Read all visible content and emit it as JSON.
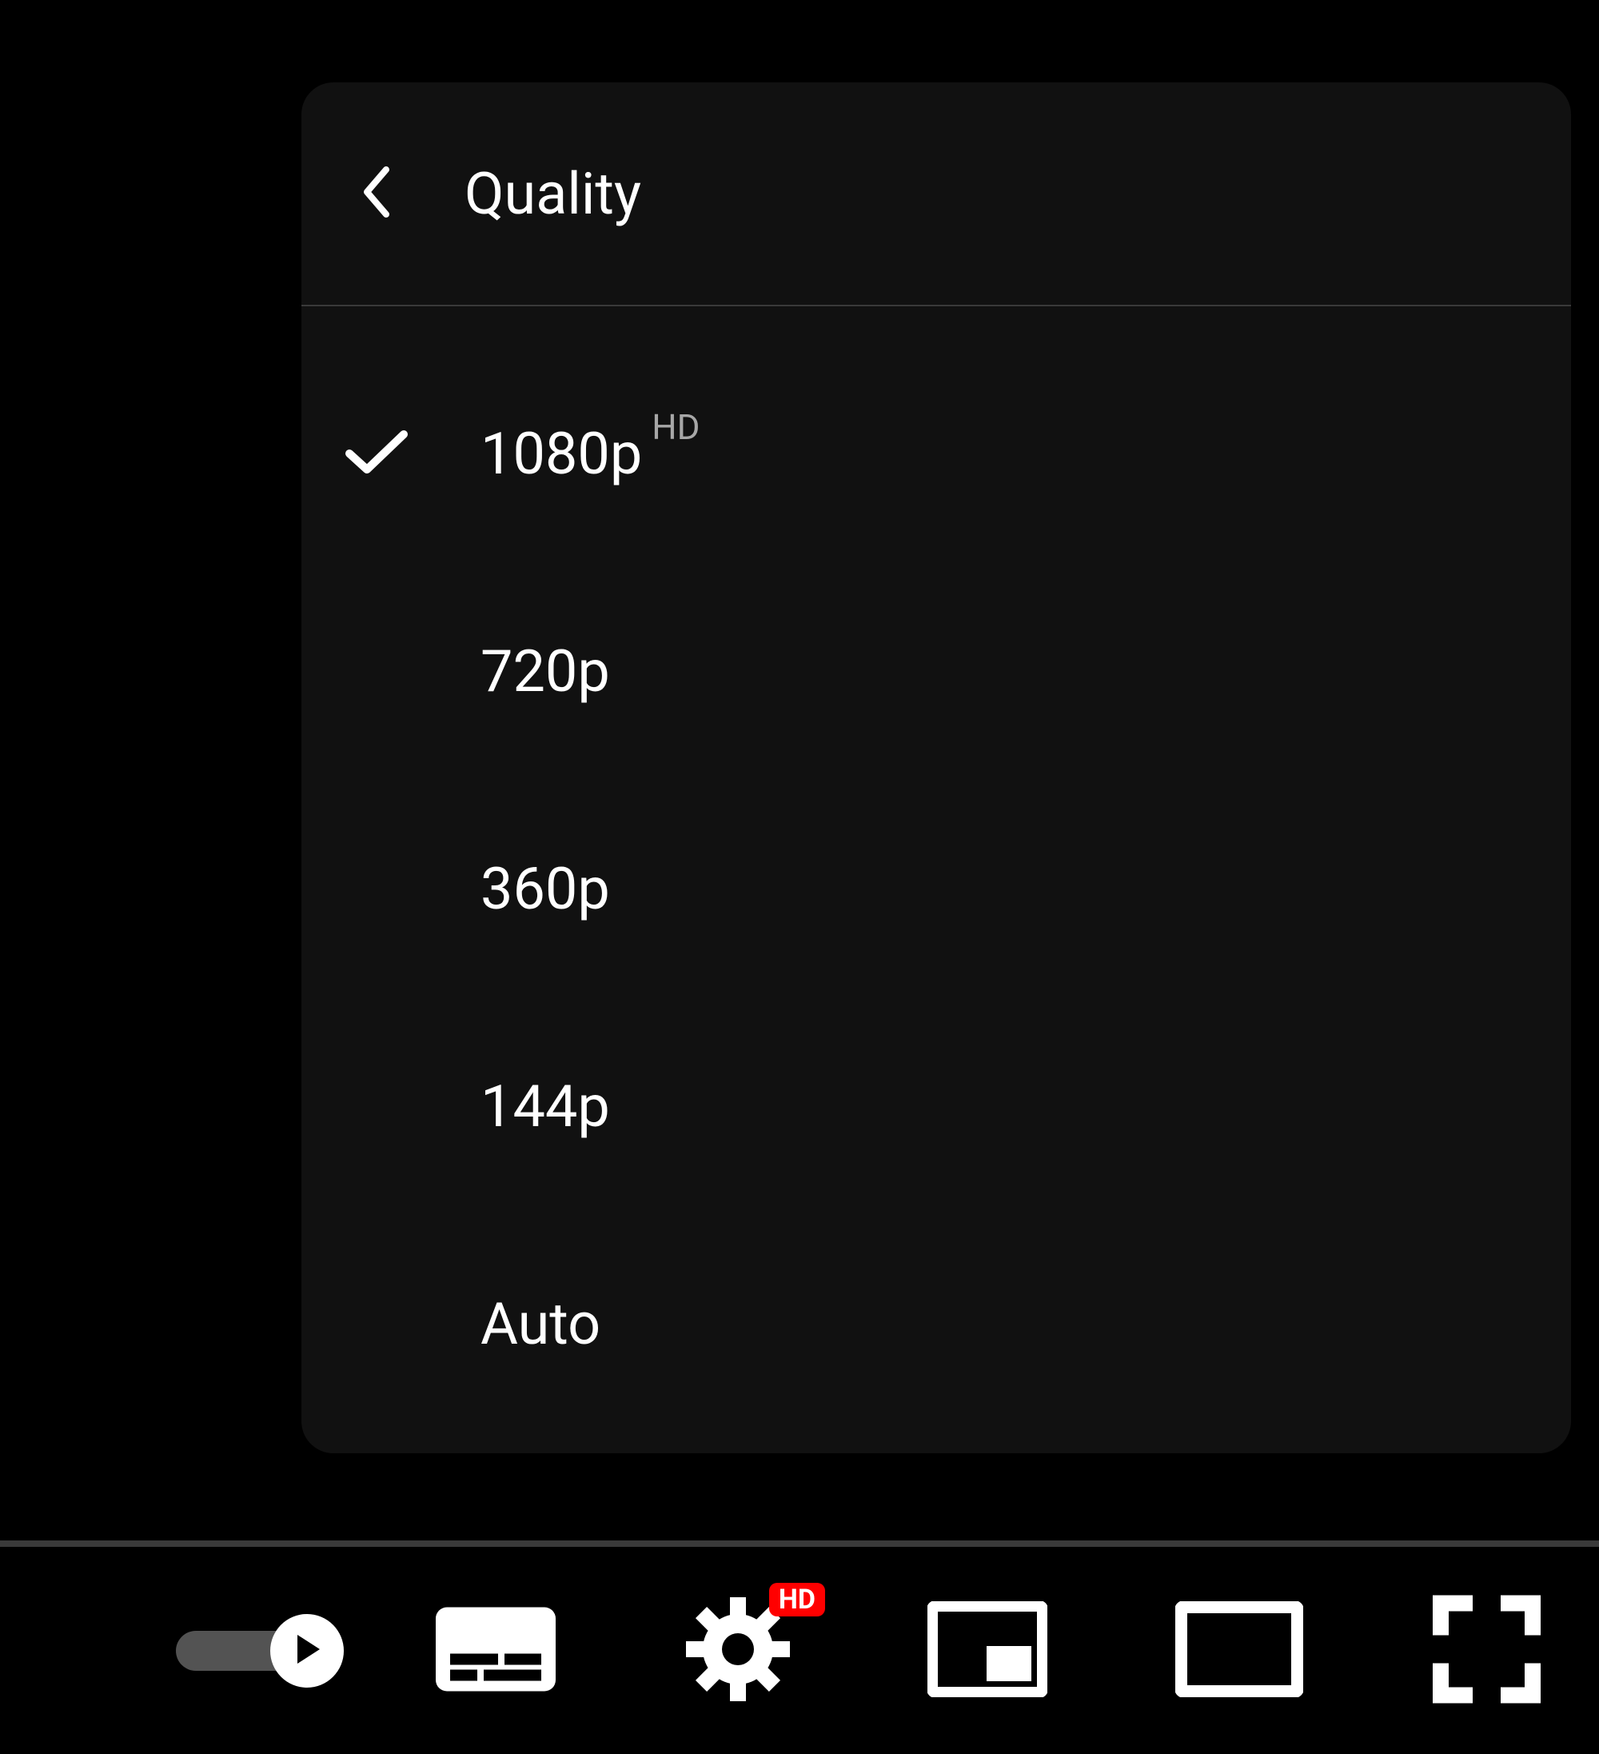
{
  "menu": {
    "title": "Quality",
    "items": [
      {
        "label": "1080p",
        "badge": "HD",
        "selected": true
      },
      {
        "label": "720p",
        "badge": "",
        "selected": false
      },
      {
        "label": "360p",
        "badge": "",
        "selected": false
      },
      {
        "label": "144p",
        "badge": "",
        "selected": false
      },
      {
        "label": "Auto",
        "badge": "",
        "selected": false
      }
    ]
  },
  "controls": {
    "settings_badge": "HD"
  }
}
